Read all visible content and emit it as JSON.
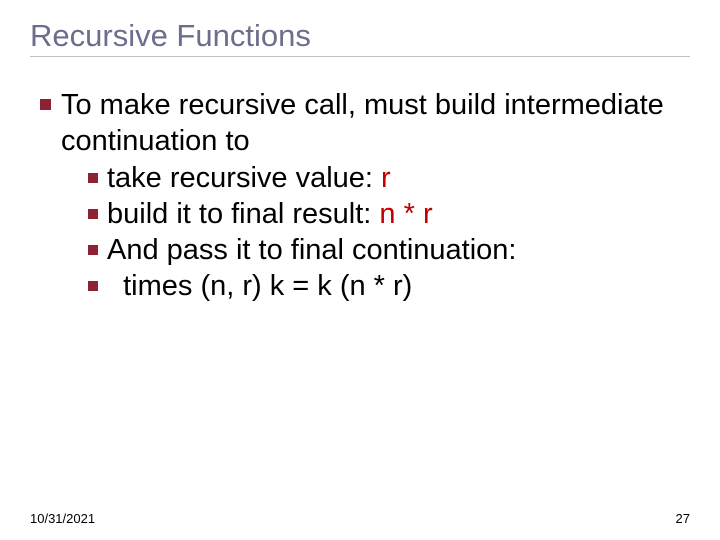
{
  "title": "Recursive Functions",
  "outer": "To make recursive call, must build intermediate continuation to",
  "items": {
    "i1a": "take recursive value:  ",
    "i1b": "r",
    "i2a": "build it to final result: ",
    "i2b": "n * r",
    "i3": "And pass it to final continuation:",
    "i4": "  times (n, r) k = k (n * r)"
  },
  "date": "10/31/2021",
  "page": "27"
}
